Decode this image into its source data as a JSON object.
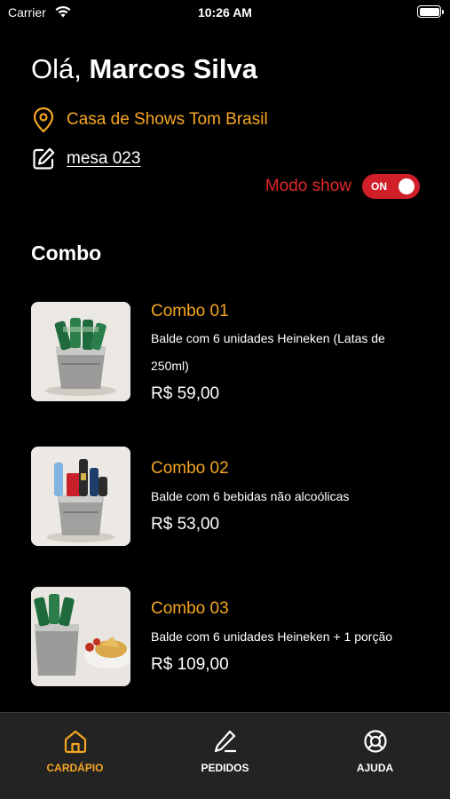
{
  "status_bar": {
    "carrier": "Carrier",
    "time": "10:26 AM"
  },
  "header": {
    "greeting_prefix": "Olá, ",
    "user_name": "Marcos Silva",
    "venue": "Casa de Shows Tom Brasil",
    "table": "mesa 023",
    "mode_label": "Modo show",
    "mode_toggle": "ON"
  },
  "section_title": "Combo",
  "combos": [
    {
      "title": "Combo 01",
      "description": "Balde com 6 unidades Heineken (Latas de 250ml)",
      "price": "R$ 59,00"
    },
    {
      "title": "Combo 02",
      "description": "Balde com 6 bebidas não alcoólicas",
      "price": "R$ 53,00"
    },
    {
      "title": "Combo 03",
      "description": "Balde com 6 unidades Heineken + 1 porção",
      "price": "R$ 109,00"
    }
  ],
  "tabs": [
    {
      "label": "CARDÁPIO",
      "icon": "home-icon",
      "active": true
    },
    {
      "label": "PEDIDOS",
      "icon": "pencil-icon",
      "active": false
    },
    {
      "label": "AJUDA",
      "icon": "lifebuoy-icon",
      "active": false
    }
  ],
  "colors": {
    "accent": "#F5A623",
    "danger": "#D01F28",
    "background": "#000000",
    "tab_bar": "#232323"
  }
}
